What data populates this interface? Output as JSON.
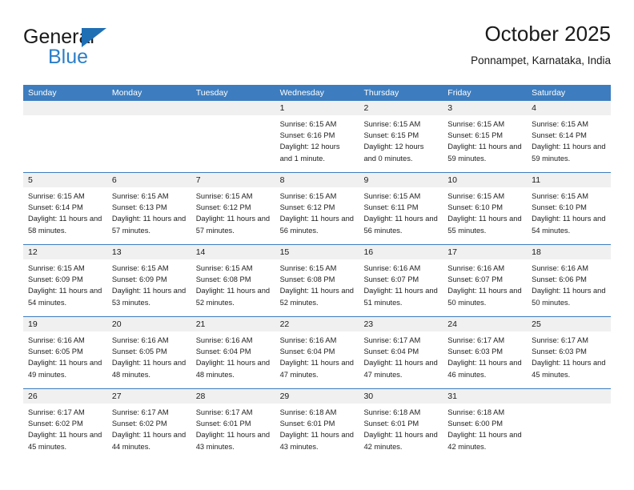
{
  "brand": {
    "name_top": "General",
    "name_bottom": "Blue",
    "accent_color": "#2a7fc9",
    "triangle_color": "#1f6fb5"
  },
  "header": {
    "title": "October 2025",
    "subtitle": "Ponnampet, Karnataka, India"
  },
  "calendar": {
    "header_bg": "#3d7dbf",
    "daynum_bg": "#f0f0f0",
    "weekdays": [
      "Sunday",
      "Monday",
      "Tuesday",
      "Wednesday",
      "Thursday",
      "Friday",
      "Saturday"
    ],
    "weeks": [
      [
        {
          "day": "",
          "empty": true
        },
        {
          "day": "",
          "empty": true
        },
        {
          "day": "",
          "empty": true
        },
        {
          "day": "1",
          "sunrise": "Sunrise: 6:15 AM",
          "sunset": "Sunset: 6:16 PM",
          "daylight": "Daylight: 12 hours and 1 minute."
        },
        {
          "day": "2",
          "sunrise": "Sunrise: 6:15 AM",
          "sunset": "Sunset: 6:15 PM",
          "daylight": "Daylight: 12 hours and 0 minutes."
        },
        {
          "day": "3",
          "sunrise": "Sunrise: 6:15 AM",
          "sunset": "Sunset: 6:15 PM",
          "daylight": "Daylight: 11 hours and 59 minutes."
        },
        {
          "day": "4",
          "sunrise": "Sunrise: 6:15 AM",
          "sunset": "Sunset: 6:14 PM",
          "daylight": "Daylight: 11 hours and 59 minutes."
        }
      ],
      [
        {
          "day": "5",
          "sunrise": "Sunrise: 6:15 AM",
          "sunset": "Sunset: 6:14 PM",
          "daylight": "Daylight: 11 hours and 58 minutes."
        },
        {
          "day": "6",
          "sunrise": "Sunrise: 6:15 AM",
          "sunset": "Sunset: 6:13 PM",
          "daylight": "Daylight: 11 hours and 57 minutes."
        },
        {
          "day": "7",
          "sunrise": "Sunrise: 6:15 AM",
          "sunset": "Sunset: 6:12 PM",
          "daylight": "Daylight: 11 hours and 57 minutes."
        },
        {
          "day": "8",
          "sunrise": "Sunrise: 6:15 AM",
          "sunset": "Sunset: 6:12 PM",
          "daylight": "Daylight: 11 hours and 56 minutes."
        },
        {
          "day": "9",
          "sunrise": "Sunrise: 6:15 AM",
          "sunset": "Sunset: 6:11 PM",
          "daylight": "Daylight: 11 hours and 56 minutes."
        },
        {
          "day": "10",
          "sunrise": "Sunrise: 6:15 AM",
          "sunset": "Sunset: 6:10 PM",
          "daylight": "Daylight: 11 hours and 55 minutes."
        },
        {
          "day": "11",
          "sunrise": "Sunrise: 6:15 AM",
          "sunset": "Sunset: 6:10 PM",
          "daylight": "Daylight: 11 hours and 54 minutes."
        }
      ],
      [
        {
          "day": "12",
          "sunrise": "Sunrise: 6:15 AM",
          "sunset": "Sunset: 6:09 PM",
          "daylight": "Daylight: 11 hours and 54 minutes."
        },
        {
          "day": "13",
          "sunrise": "Sunrise: 6:15 AM",
          "sunset": "Sunset: 6:09 PM",
          "daylight": "Daylight: 11 hours and 53 minutes."
        },
        {
          "day": "14",
          "sunrise": "Sunrise: 6:15 AM",
          "sunset": "Sunset: 6:08 PM",
          "daylight": "Daylight: 11 hours and 52 minutes."
        },
        {
          "day": "15",
          "sunrise": "Sunrise: 6:15 AM",
          "sunset": "Sunset: 6:08 PM",
          "daylight": "Daylight: 11 hours and 52 minutes."
        },
        {
          "day": "16",
          "sunrise": "Sunrise: 6:16 AM",
          "sunset": "Sunset: 6:07 PM",
          "daylight": "Daylight: 11 hours and 51 minutes."
        },
        {
          "day": "17",
          "sunrise": "Sunrise: 6:16 AM",
          "sunset": "Sunset: 6:07 PM",
          "daylight": "Daylight: 11 hours and 50 minutes."
        },
        {
          "day": "18",
          "sunrise": "Sunrise: 6:16 AM",
          "sunset": "Sunset: 6:06 PM",
          "daylight": "Daylight: 11 hours and 50 minutes."
        }
      ],
      [
        {
          "day": "19",
          "sunrise": "Sunrise: 6:16 AM",
          "sunset": "Sunset: 6:05 PM",
          "daylight": "Daylight: 11 hours and 49 minutes."
        },
        {
          "day": "20",
          "sunrise": "Sunrise: 6:16 AM",
          "sunset": "Sunset: 6:05 PM",
          "daylight": "Daylight: 11 hours and 48 minutes."
        },
        {
          "day": "21",
          "sunrise": "Sunrise: 6:16 AM",
          "sunset": "Sunset: 6:04 PM",
          "daylight": "Daylight: 11 hours and 48 minutes."
        },
        {
          "day": "22",
          "sunrise": "Sunrise: 6:16 AM",
          "sunset": "Sunset: 6:04 PM",
          "daylight": "Daylight: 11 hours and 47 minutes."
        },
        {
          "day": "23",
          "sunrise": "Sunrise: 6:17 AM",
          "sunset": "Sunset: 6:04 PM",
          "daylight": "Daylight: 11 hours and 47 minutes."
        },
        {
          "day": "24",
          "sunrise": "Sunrise: 6:17 AM",
          "sunset": "Sunset: 6:03 PM",
          "daylight": "Daylight: 11 hours and 46 minutes."
        },
        {
          "day": "25",
          "sunrise": "Sunrise: 6:17 AM",
          "sunset": "Sunset: 6:03 PM",
          "daylight": "Daylight: 11 hours and 45 minutes."
        }
      ],
      [
        {
          "day": "26",
          "sunrise": "Sunrise: 6:17 AM",
          "sunset": "Sunset: 6:02 PM",
          "daylight": "Daylight: 11 hours and 45 minutes."
        },
        {
          "day": "27",
          "sunrise": "Sunrise: 6:17 AM",
          "sunset": "Sunset: 6:02 PM",
          "daylight": "Daylight: 11 hours and 44 minutes."
        },
        {
          "day": "28",
          "sunrise": "Sunrise: 6:17 AM",
          "sunset": "Sunset: 6:01 PM",
          "daylight": "Daylight: 11 hours and 43 minutes."
        },
        {
          "day": "29",
          "sunrise": "Sunrise: 6:18 AM",
          "sunset": "Sunset: 6:01 PM",
          "daylight": "Daylight: 11 hours and 43 minutes."
        },
        {
          "day": "30",
          "sunrise": "Sunrise: 6:18 AM",
          "sunset": "Sunset: 6:01 PM",
          "daylight": "Daylight: 11 hours and 42 minutes."
        },
        {
          "day": "31",
          "sunrise": "Sunrise: 6:18 AM",
          "sunset": "Sunset: 6:00 PM",
          "daylight": "Daylight: 11 hours and 42 minutes."
        },
        {
          "day": "",
          "empty": true
        }
      ]
    ]
  }
}
